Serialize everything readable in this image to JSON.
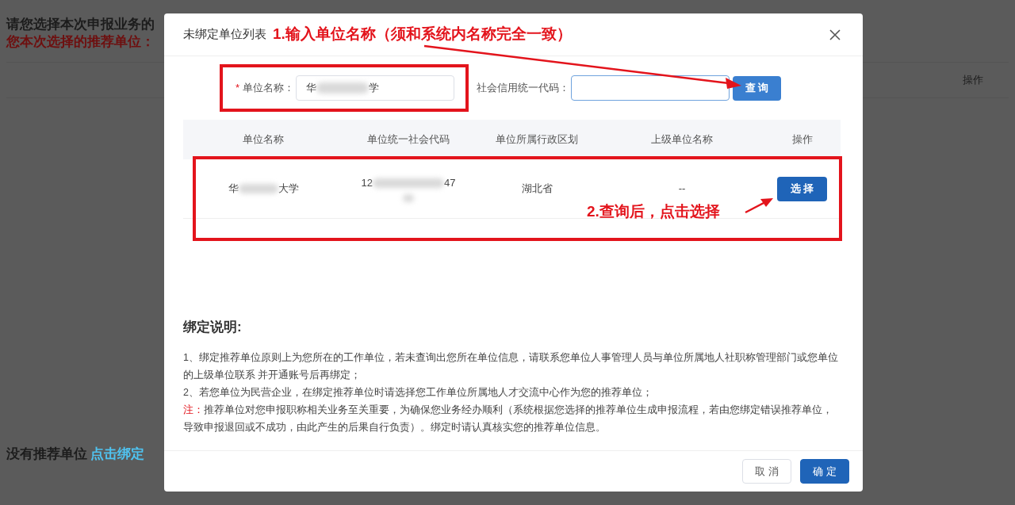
{
  "background": {
    "heading": "请您选择本次申报业务的",
    "selection_label": "您本次选择的推荐单位：",
    "column": "操作",
    "no_unit_text": "没有推荐单位",
    "bind_link": "点击绑定"
  },
  "dialog": {
    "title": "未绑定单位列表",
    "form": {
      "required_mark": "*",
      "name_label": "单位名称：",
      "name_value_start": "华",
      "name_value_end": "学",
      "credit_code_label": "社会信用统一代码：",
      "search_button": "查 询"
    },
    "table": {
      "columns": [
        "单位名称",
        "单位统一社会代码",
        "单位所属行政区划",
        "上级单位名称",
        "操作"
      ],
      "rows": [
        {
          "name_start": "华",
          "name_end": "大学",
          "code_start": "12",
          "code_end": "47",
          "region": "湖北省",
          "parent": "--",
          "action": "选 择"
        }
      ]
    },
    "notes": {
      "heading": "绑定说明:",
      "items": [
        {
          "kind": "plain",
          "text": "1、绑定推荐单位原则上为您所在的工作单位，若未查询出您所在单位信息，请联系您单位人事管理人员与单位所属地人社职称管理部门或您单位的上级单位联系 并开通账号后再绑定；"
        },
        {
          "kind": "plain",
          "text": "2、若您单位为民营企业，在绑定推荐单位时请选择您工作单位所属地人才交流中心作为您的推荐单位；"
        },
        {
          "kind": "warning",
          "prefix": "注：",
          "text": "推荐单位对您申报职称相关业务至关重要，为确保您业务经办顺利（系统根据您选择的推荐单位生成申报流程，若由您绑定错误推荐单位，导致申报退回或不成功，由此产生的后果自行负责）。绑定时请认真核实您的推荐单位信息。"
        }
      ]
    },
    "buttons": [
      {
        "label": "取 消",
        "kind": "secondary"
      },
      {
        "label": "确 定",
        "kind": "primary"
      }
    ]
  },
  "annotations": [
    {
      "text": "1.输入单位名称（须和系统内名称完全一致）"
    },
    {
      "text": "2.查询后，点击选择"
    }
  ]
}
